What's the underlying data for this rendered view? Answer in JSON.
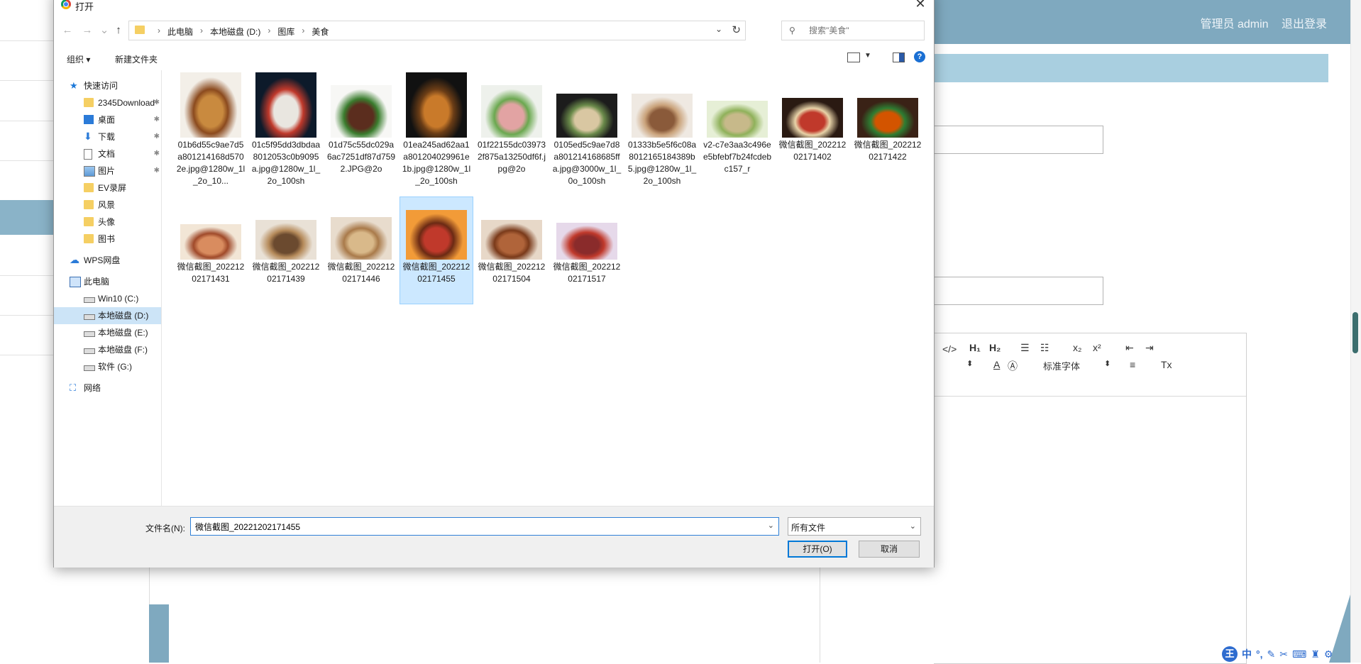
{
  "background": {
    "user": "管理员 admin",
    "logout": "退出登录",
    "editor": {
      "h1": "H₁",
      "h2": "H₂",
      "sub": "x₂",
      "sup": "x²",
      "font": "标准字体"
    }
  },
  "ime": {
    "logo": "王",
    "mode": "中"
  },
  "dialog": {
    "title": "打开",
    "close": "✕",
    "nav": {
      "back": "←",
      "forward": "→",
      "recent": "⌄",
      "up": "↑"
    },
    "breadcrumbs": [
      "此电脑",
      "本地磁盘 (D:)",
      "图库",
      "美食"
    ],
    "search_placeholder": "搜索\"美食\"",
    "toolbar": {
      "organize": "组织 ▾",
      "new_folder": "新建文件夹",
      "help": "?"
    },
    "sidebar": [
      {
        "label": "快速访问",
        "icon": "star-icon"
      },
      {
        "label": "2345Download",
        "icon": "folder-icon",
        "pinned": true
      },
      {
        "label": "桌面",
        "icon": "desktop-icon",
        "pinned": true
      },
      {
        "label": "下载",
        "icon": "download-icon",
        "pinned": true
      },
      {
        "label": "文档",
        "icon": "document-icon",
        "pinned": true
      },
      {
        "label": "图片",
        "icon": "pictures-icon",
        "pinned": true
      },
      {
        "label": "EV录屏",
        "icon": "folder-icon"
      },
      {
        "label": "风景",
        "icon": "folder-icon"
      },
      {
        "label": "头像",
        "icon": "folder-icon"
      },
      {
        "label": "图书",
        "icon": "folder-icon"
      },
      {
        "label": "WPS网盘",
        "icon": "cloud-icon"
      },
      {
        "label": "此电脑",
        "icon": "computer-icon"
      },
      {
        "label": "Win10 (C:)",
        "icon": "drive-icon"
      },
      {
        "label": "本地磁盘 (D:)",
        "icon": "drive-icon",
        "selected": true
      },
      {
        "label": "本地磁盘 (E:)",
        "icon": "drive-icon"
      },
      {
        "label": "本地磁盘 (F:)",
        "icon": "drive-icon"
      },
      {
        "label": "软件 (G:)",
        "icon": "drive-icon"
      },
      {
        "label": "网络",
        "icon": "network-icon"
      }
    ],
    "files": [
      {
        "name": "01b6d55c9ae7d5a801214168d5702e.jpg@1280w_1l_2o_10...",
        "colors": [
          "#f3efe8",
          "#c98a3f",
          "#8b4a1e"
        ]
      },
      {
        "name": "01c5f95dd3dbdaa8012053c0b9095a.jpg@1280w_1l_2o_100sh",
        "colors": [
          "#0d1a2a",
          "#e9e6e0",
          "#c0392b"
        ]
      },
      {
        "name": "01d75c55dc029a6ac7251df87d7592.JPG@2o",
        "colors": [
          "#f7f7f5",
          "#5b2d1e",
          "#3a7d2e"
        ]
      },
      {
        "name": "01ea245ad62aa1a801204029961e1b.jpg@1280w_1l_2o_100sh",
        "colors": [
          "#111111",
          "#c97a2a",
          "#6b3d16"
        ]
      },
      {
        "name": "01f22155dc039732f875a13250df6f.jpg@2o",
        "colors": [
          "#eef1ec",
          "#e2a3a3",
          "#6aa84f"
        ]
      },
      {
        "name": "0105ed5c9ae7d8a801214168685ffa.jpg@3000w_1l_0o_100sh",
        "colors": [
          "#1c1c1c",
          "#d9c7a2",
          "#6a8a4a"
        ]
      },
      {
        "name": "01333b5e5f6c08a8012165184389b5.jpg@1280w_1l_2o_100sh",
        "colors": [
          "#efe9e2",
          "#8a5a3a",
          "#c9a27a"
        ]
      },
      {
        "name": "v2-c7e3aa3c496ee5bfebf7b24fcdebc157_r",
        "colors": [
          "#e6efd6",
          "#c7b98a",
          "#8fb15a"
        ]
      },
      {
        "name": "微信截图_20221202171402",
        "colors": [
          "#2a1a12",
          "#c0392b",
          "#e8d3a8"
        ]
      },
      {
        "name": "微信截图_20221202171422",
        "colors": [
          "#3a2216",
          "#d35400",
          "#2e7d32"
        ]
      },
      {
        "name": "微信截图_20221202171431",
        "colors": [
          "#f2e6d6",
          "#d98c5f",
          "#a04a2a"
        ]
      },
      {
        "name": "微信截图_20221202171439",
        "colors": [
          "#e9e1d6",
          "#6b4a2f",
          "#b58a5a"
        ]
      },
      {
        "name": "微信截图_20221202171446",
        "colors": [
          "#e8dccd",
          "#d9b98a",
          "#a97a4a"
        ]
      },
      {
        "name": "微信截图_20221202171455",
        "colors": [
          "#f29b38",
          "#c0392b",
          "#6b2a14"
        ],
        "selected": true
      },
      {
        "name": "微信截图_20221202171504",
        "colors": [
          "#e7d8c8",
          "#b0643a",
          "#7a3a1a"
        ]
      },
      {
        "name": "微信截图_20221202171517",
        "colors": [
          "#e6d9ea",
          "#8a2b2b",
          "#c0392b"
        ]
      }
    ],
    "footer": {
      "filename_label": "文件名(N):",
      "filename_value": "微信截图_20221202171455",
      "filetype": "所有文件",
      "open": "打开(O)",
      "cancel": "取消"
    }
  }
}
